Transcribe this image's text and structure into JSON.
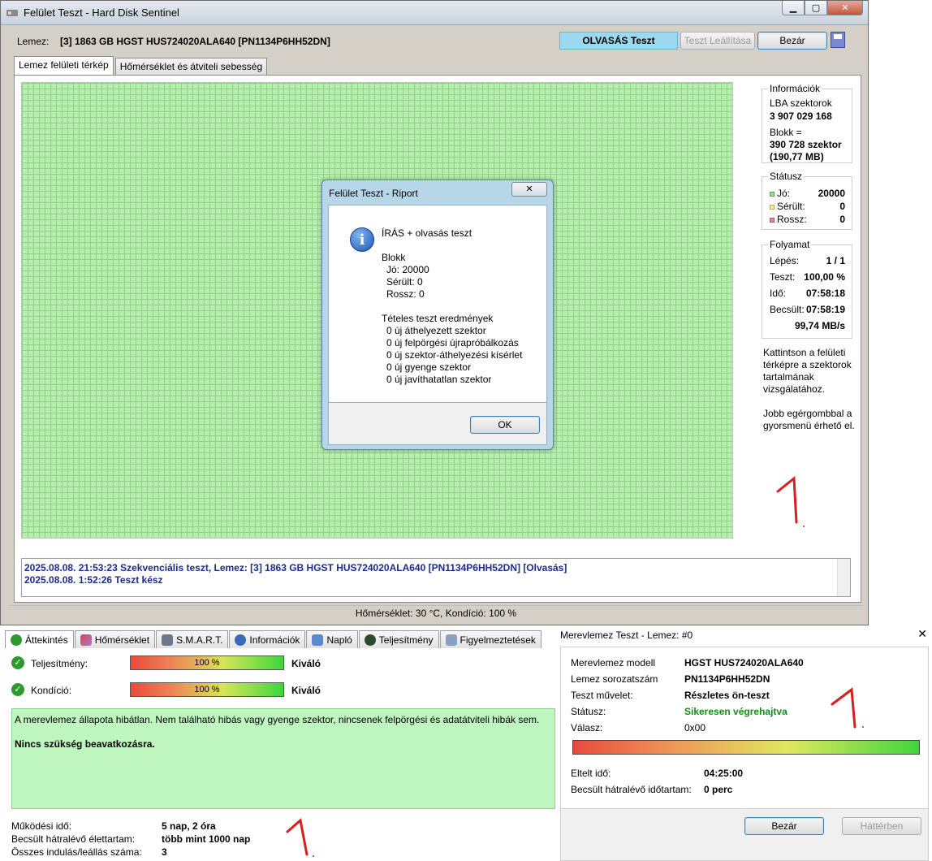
{
  "main_window": {
    "title": "Felület Teszt - Hard Disk Sentinel",
    "disk_label": "Lemez:",
    "disk_name": "[3] 1863 GB  HGST HUS724020ALA640 [PN1134P6HH52DN]",
    "test_mode": "OLVASÁS Teszt",
    "stop_button": "Teszt Leállítása",
    "close_button": "Bezár",
    "tabs": [
      {
        "label": "Lemez felületi térkép"
      },
      {
        "label": "Hőmérséklet és átviteli sebesség"
      }
    ],
    "info": {
      "group_title": "Információk",
      "lba_label": "LBA szektorok",
      "lba_value": "3 907 029 168",
      "block_label": "Blokk =",
      "block_value": "390 728 szektor",
      "block_size": "(190,77 MB)"
    },
    "status": {
      "group_title": "Státusz",
      "good_label": "Jó:",
      "good_value": "20000",
      "damaged_label": "Sérült:",
      "damaged_value": "0",
      "bad_label": "Rossz:",
      "bad_value": "0"
    },
    "progress": {
      "group_title": "Folyamat",
      "step_label": "Lépés:",
      "step_value": "1 / 1",
      "test_label": "Teszt:",
      "test_value": "100,00 %",
      "time_label": "Idő:",
      "time_value": "07:58:18",
      "est_label": "Becsült:",
      "est_value": "07:58:19",
      "speed_value": "99,74 MB/s"
    },
    "hint1": "Kattintson a felületi térképre a szektorok tartalmának vizsgálatához.",
    "hint2": "Jobb egérgombbal a gyorsmenü érhető el.",
    "log": [
      "2025.08.08.  21:53:23   Szekvenciális teszt, Lemez: [3] 1863 GB  HGST HUS724020ALA640 [PN1134P6HH52DN] [Olvasás]",
      "2025.08.08.  1:52:26   Teszt kész"
    ],
    "status_bar": "Hőmérséklet: 30  °C,  Kondíció: 100 %"
  },
  "dialog": {
    "title": "Felület Teszt - Riport",
    "heading": "ÍRÁS + olvasás teszt",
    "block_title": "Blokk",
    "good": "Jó: 20000",
    "damaged": "Sérült: 0",
    "bad": "Rossz: 0",
    "results_title": "Tételes teszt eredmények",
    "results": [
      "0 új áthelyezett szektor",
      "0 új felpörgési újrapróbálkozás",
      "0 új szektor-áthelyezési kísérlet",
      "0 új gyenge szektor",
      "0 új javíthatatlan szektor"
    ],
    "ok_button": "OK"
  },
  "overview": {
    "tabs": [
      {
        "label": "Áttekintés",
        "icon": "check-icon"
      },
      {
        "label": "Hőmérséklet",
        "icon": "thermometer-icon"
      },
      {
        "label": "S.M.A.R.T.",
        "icon": "chip-icon"
      },
      {
        "label": "Információk",
        "icon": "info-icon"
      },
      {
        "label": "Napló",
        "icon": "log-icon"
      },
      {
        "label": "Teljesítmény",
        "icon": "gauge-icon"
      },
      {
        "label": "Figyelmeztetések",
        "icon": "warning-doc-icon"
      }
    ],
    "performance_label": "Teljesítmény:",
    "performance_value": "100 %",
    "performance_percent": 100,
    "performance_rating": "Kiváló",
    "health_label": "Kondíció:",
    "health_value": "100 %",
    "health_percent": 100,
    "health_rating": "Kiváló",
    "summary": "A merevlemez állapota hibátlan. Nem található hibás vagy gyenge szektor, nincsenek felpörgési és adatátviteli hibák sem.",
    "action": "Nincs szükség beavatkozásra.",
    "power_on_label": "Működési idő:",
    "power_on_value": "5 nap, 2 óra",
    "lifetime_label": "Becsült hátralévő élettartam:",
    "lifetime_value": "több mint 1000 nap",
    "starts_label": "Összes indulás/leállás száma:",
    "starts_value": "3"
  },
  "hdd_test": {
    "title": "Merevlemez Teszt - Lemez: #0",
    "model_label": "Merevlemez modell",
    "model_value": "HGST HUS724020ALA640",
    "serial_label": "Lemez sorozatszám",
    "serial_value": "PN1134P6HH52DN",
    "op_label": "Teszt művelet:",
    "op_value": "Részletes ön-teszt",
    "status_label": "Státusz:",
    "status_value": "Sikeresen végrehajtva",
    "answer_label": "Válasz:",
    "answer_value": "0x00",
    "progress_percent": 100,
    "elapsed_label": "Eltelt idő:",
    "elapsed_value": "04:25:00",
    "remaining_label": "Becsült hátralévő időtartam:",
    "remaining_value": "0 perc",
    "close_button": "Bezár",
    "background_button": "Háttérben"
  },
  "colors": {
    "accent_blue": "#9bd9f0",
    "grid_green": "#b8edb0",
    "status_green": "#1a8a1a",
    "log_blue": "#1c2b8c"
  }
}
